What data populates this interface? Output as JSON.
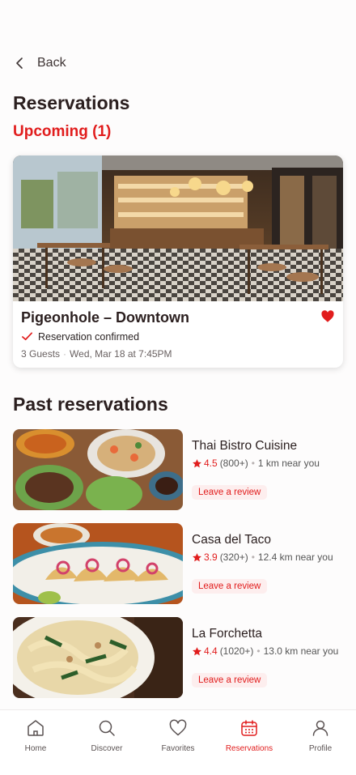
{
  "header": {
    "back_label": "Back",
    "title": "Reservations"
  },
  "upcoming": {
    "heading": "Upcoming (1)",
    "card": {
      "name": "Pigeonhole – Downtown",
      "status": "Reservation confirmed",
      "guests": "3 Guests",
      "datetime": "Wed, Mar 18 at 7:45PM",
      "favorited": true
    }
  },
  "past": {
    "heading": "Past reservations",
    "items": [
      {
        "name": "Thai Bistro Cuisine",
        "rating": "4.5",
        "reviews": "(800+)",
        "distance": "1 km near you",
        "action": "Leave a review"
      },
      {
        "name": "Casa del Taco",
        "rating": "3.9",
        "reviews": "(320+)",
        "distance": "12.4 km near you",
        "action": "Leave a review"
      },
      {
        "name": "La Forchetta",
        "rating": "4.4",
        "reviews": "(1020+)",
        "distance": "13.0 km near you",
        "action": "Leave a review"
      }
    ]
  },
  "tabs": [
    {
      "label": "Home",
      "icon": "home-icon"
    },
    {
      "label": "Discover",
      "icon": "search-icon"
    },
    {
      "label": "Favorites",
      "icon": "heart-icon"
    },
    {
      "label": "Reservations",
      "icon": "calendar-icon",
      "active": true
    },
    {
      "label": "Profile",
      "icon": "user-icon"
    }
  ],
  "colors": {
    "accent": "#e11d1d",
    "text": "#2b1f1f",
    "review_bg": "#fdeeee"
  }
}
